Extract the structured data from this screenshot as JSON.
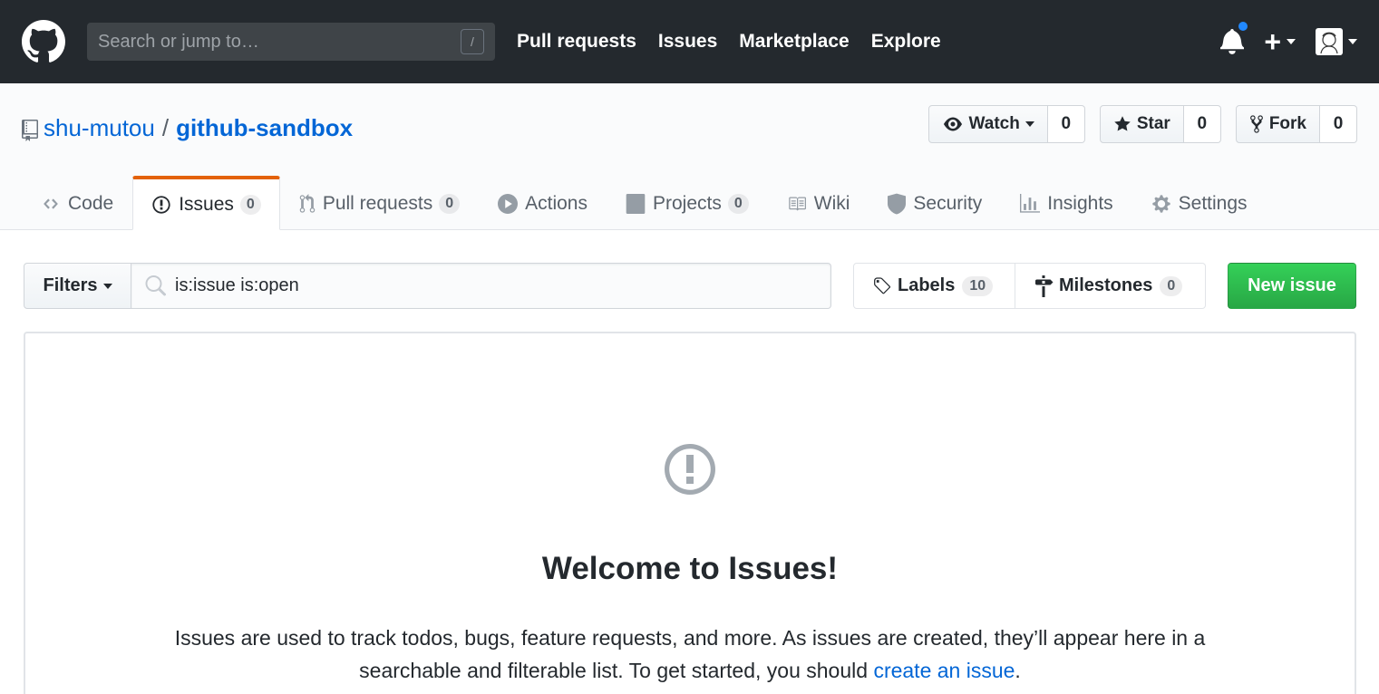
{
  "header": {
    "search_placeholder": "Search or jump to…",
    "search_key": "/",
    "nav": [
      "Pull requests",
      "Issues",
      "Marketplace",
      "Explore"
    ]
  },
  "repo": {
    "owner": "shu-mutou",
    "separator": "/",
    "name": "github-sandbox",
    "watch_label": "Watch",
    "watch_count": "0",
    "star_label": "Star",
    "star_count": "0",
    "fork_label": "Fork",
    "fork_count": "0"
  },
  "tabs": [
    {
      "label": "Code",
      "icon": "code-icon"
    },
    {
      "label": "Issues",
      "count": "0",
      "icon": "issue-opened-icon",
      "selected": true
    },
    {
      "label": "Pull requests",
      "count": "0",
      "icon": "git-pull-request-icon"
    },
    {
      "label": "Actions",
      "icon": "play-icon"
    },
    {
      "label": "Projects",
      "count": "0",
      "icon": "project-icon"
    },
    {
      "label": "Wiki",
      "icon": "book-icon"
    },
    {
      "label": "Security",
      "icon": "shield-icon"
    },
    {
      "label": "Insights",
      "icon": "graph-icon"
    },
    {
      "label": "Settings",
      "icon": "gear-icon"
    }
  ],
  "subnav": {
    "filters_label": "Filters",
    "search_value": "is:issue is:open",
    "labels_label": "Labels",
    "labels_count": "10",
    "milestones_label": "Milestones",
    "milestones_count": "0",
    "new_issue_label": "New issue"
  },
  "blankslate": {
    "title": "Welcome to Issues!",
    "text_before": "Issues are used to track todos, bugs, feature requests, and more. As issues are created, they’ll appear here in a searchable and filterable list. To get started, you should ",
    "link": "create an issue",
    "text_after": "."
  },
  "colors": {
    "header_bg": "#24292e",
    "link": "#0366d6",
    "selected_tab_accent": "#e36209",
    "primary_button": "#28a745",
    "notification_dot": "#2188ff"
  }
}
